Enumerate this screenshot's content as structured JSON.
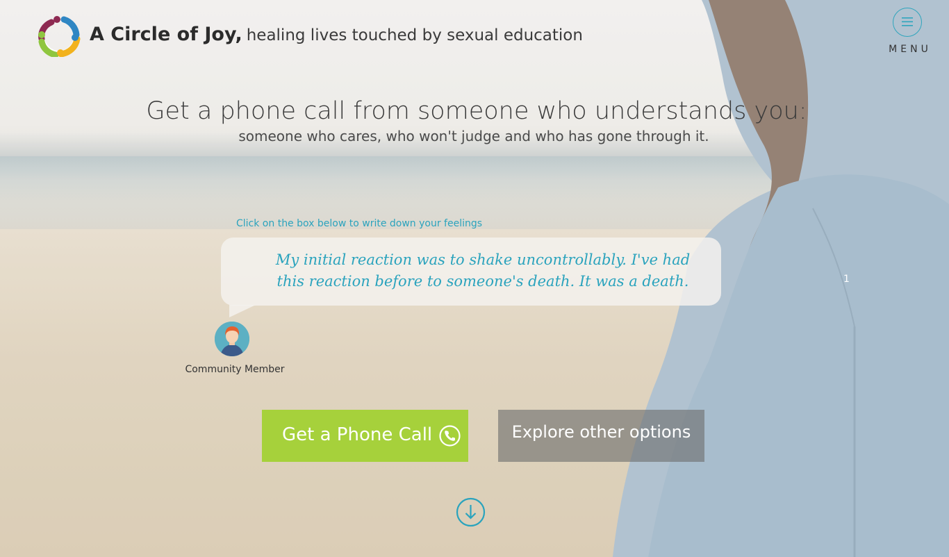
{
  "header": {
    "brand_name": "A Circle of Joy,",
    "brand_tagline": "healing lives touched by sexual education",
    "menu_label": "MENU"
  },
  "hero": {
    "headline": "Get a phone call from someone who understands you:",
    "subheadline": "someone who cares, who won't judge and who has gone through it."
  },
  "story": {
    "hint": "Click on the box below to write down your feelings",
    "quote": "My initial reaction was to shake uncontrollably. I've had this reaction before to someone's death. It was a death.",
    "author_label": "Community Member",
    "slide_number": "1"
  },
  "actions": {
    "phone_call_label": "Get a Phone Call",
    "explore_label": "Explore other options"
  },
  "colors": {
    "accent_teal": "#2aa3bd",
    "call_button_green": "#a6d13b",
    "explore_button_gray": "#6e6e6e"
  },
  "icons": {
    "logo": "circle-of-people-logo",
    "menu": "hamburger-icon",
    "phone": "phone-icon",
    "scroll": "arrow-down-circle-icon"
  }
}
